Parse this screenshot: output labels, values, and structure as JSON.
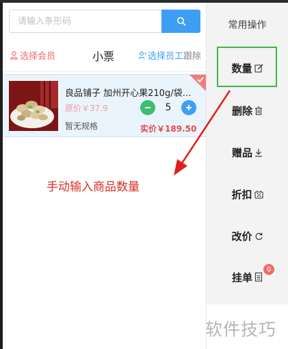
{
  "search": {
    "placeholder": "请输入条形码",
    "button_icon": "search-icon"
  },
  "member_bar": {
    "select_member": "选择会员",
    "ticket_label": "小票",
    "select_staff": "选择员工",
    "follow_label": "跟除"
  },
  "cart_item": {
    "name": "良品铺子 加州开心果210g/袋…",
    "original_price": "原价￥37.9",
    "spec": "暂无规格",
    "quantity": "5",
    "actual_price": "实价￥189.50"
  },
  "annotation": {
    "text": "手动输入商品数量"
  },
  "operations": {
    "title": "常用操作",
    "items": [
      {
        "label": "数量",
        "icon": "edit-icon"
      },
      {
        "label": "删除",
        "icon": "trash-icon"
      },
      {
        "label": "赠品",
        "icon": "download-icon"
      },
      {
        "label": "折扣",
        "icon": "discount-icon"
      },
      {
        "label": "改价",
        "icon": "refresh-icon"
      },
      {
        "label": "挂单",
        "icon": "document-icon",
        "badge": "0"
      }
    ]
  },
  "watermark": "软件技巧",
  "colors": {
    "accent_blue": "#3e9ef6",
    "member_red": "#f06a6a",
    "highlight_green": "#3bb54a",
    "annotation_red": "#d93025"
  }
}
